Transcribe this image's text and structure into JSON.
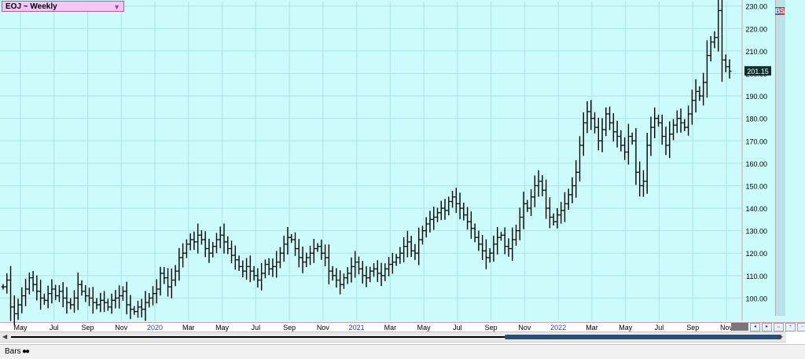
{
  "symbol": "EOJ ~ Weekly",
  "last_price": "201.15",
  "status_bar": {
    "label": "Bars",
    "icon": "infinity-icon"
  },
  "badge": {
    "b": "B",
    "s": "S",
    "b_color": "#3b5bd6",
    "s_color": "#d23a3a"
  },
  "colors": {
    "background": "#ccfbfb",
    "grid": "#a9e3e3",
    "bar": "#000000",
    "year_label": "#2b44d6"
  },
  "chart_data": {
    "type": "ohlc",
    "title": "EOJ ~ Weekly",
    "ylim": [
      90,
      232
    ],
    "yticks": [
      "100.00",
      "110.00",
      "120.00",
      "130.00",
      "140.00",
      "150.00",
      "160.00",
      "170.00",
      "180.00",
      "190.00",
      "200.00",
      "210.00",
      "220.00",
      "230.00"
    ],
    "xticks": [
      {
        "label": "May",
        "year": false
      },
      {
        "label": "Jul",
        "year": false
      },
      {
        "label": "Sep",
        "year": false
      },
      {
        "label": "Nov",
        "year": false
      },
      {
        "label": "2020",
        "year": true
      },
      {
        "label": "Mar",
        "year": false
      },
      {
        "label": "May",
        "year": false
      },
      {
        "label": "Jul",
        "year": false
      },
      {
        "label": "Sep",
        "year": false
      },
      {
        "label": "Nov",
        "year": false
      },
      {
        "label": "2021",
        "year": true
      },
      {
        "label": "Mar",
        "year": false
      },
      {
        "label": "May",
        "year": false
      },
      {
        "label": "Jul",
        "year": false
      },
      {
        "label": "Sep",
        "year": false
      },
      {
        "label": "Nov",
        "year": false
      },
      {
        "label": "2022",
        "year": true
      },
      {
        "label": "Mar",
        "year": false
      },
      {
        "label": "May",
        "year": false
      },
      {
        "label": "Jul",
        "year": false
      },
      {
        "label": "Sep",
        "year": false
      },
      {
        "label": "Nov",
        "year": false
      }
    ],
    "grid": true,
    "close_series": [
      105,
      108,
      96,
      93,
      97,
      101,
      104,
      109,
      106,
      103,
      100,
      99,
      102,
      104,
      101,
      103,
      100,
      98,
      97,
      100,
      106,
      103,
      101,
      100,
      98,
      97,
      99,
      98,
      96,
      99,
      100,
      101,
      103,
      97,
      95,
      94,
      96,
      95,
      98,
      100,
      102,
      104,
      111,
      109,
      105,
      108,
      112,
      118,
      120,
      124,
      126,
      125,
      128,
      126,
      122,
      120,
      123,
      126,
      128,
      125,
      122,
      119,
      117,
      114,
      112,
      114,
      112,
      110,
      108,
      111,
      115,
      113,
      114,
      116,
      120,
      124,
      127,
      126,
      122,
      118,
      116,
      118,
      120,
      122,
      123,
      120,
      118,
      112,
      110,
      108,
      106,
      109,
      111,
      114,
      116,
      113,
      110,
      109,
      112,
      113,
      111,
      110,
      113,
      115,
      116,
      118,
      120,
      123,
      125,
      121,
      120,
      126,
      130,
      133,
      135,
      136,
      138,
      140,
      139,
      143,
      145,
      142,
      140,
      137,
      134,
      131,
      127,
      124,
      121,
      118,
      120,
      124,
      127,
      128,
      123,
      122,
      126,
      130,
      136,
      142,
      140,
      145,
      150,
      152,
      148,
      140,
      136,
      134,
      137,
      139,
      142,
      146,
      150,
      156,
      168,
      178,
      183,
      180,
      176,
      170,
      175,
      182,
      178,
      174,
      172,
      168,
      165,
      172,
      170,
      156,
      150,
      152,
      168,
      176,
      180,
      178,
      172,
      168,
      173,
      177,
      180,
      178,
      176,
      182,
      188,
      192,
      190,
      196,
      208,
      214,
      216,
      228,
      206,
      203,
      201
    ]
  }
}
